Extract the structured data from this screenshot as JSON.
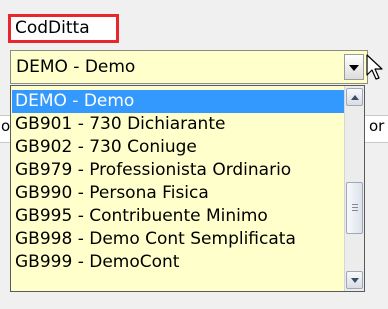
{
  "field": {
    "label": "CodDitta",
    "selected_value": "DEMO - Demo"
  },
  "dropdown": {
    "options": [
      "DEMO - Demo",
      "GB901 - 730 Dichiarante",
      "GB902 - 730 Coniuge",
      "GB979 - Professionista Ordinario",
      "GB990 - Persona Fisica",
      "GB995 - Contribuente Minimo",
      "GB998 - Demo Cont Semplificata",
      "GB999 - DemoCont"
    ],
    "selected_index": 0
  },
  "background_fragments": {
    "left": "o",
    "right": "or"
  },
  "icons": {
    "dropdown_button": "chevron-down-icon",
    "cursor": "mouse-pointer-icon",
    "scroll_up": "scroll-up-arrow-icon",
    "scroll_down": "scroll-down-arrow-icon"
  },
  "colors": {
    "highlight_border": "#e8272d",
    "field_background": "#ffffcc",
    "selection": "#3399ff"
  }
}
